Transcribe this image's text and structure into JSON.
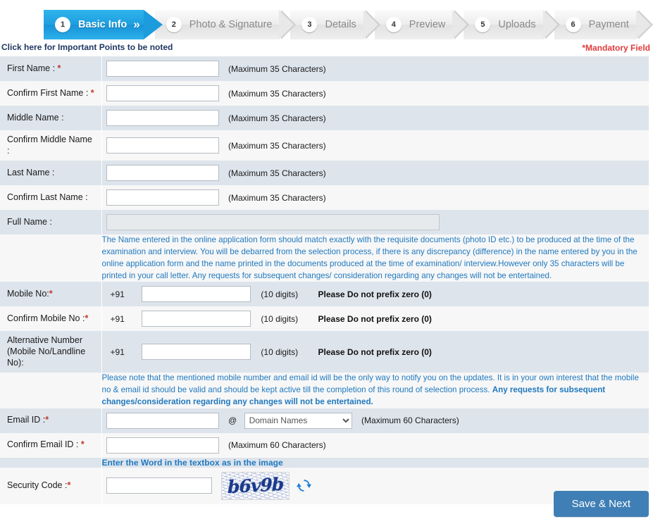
{
  "wizard": {
    "steps": [
      {
        "num": "1",
        "label": "Basic Info",
        "active": true
      },
      {
        "num": "2",
        "label": "Photo & Signature",
        "active": false
      },
      {
        "num": "3",
        "label": "Details",
        "active": false
      },
      {
        "num": "4",
        "label": "Preview",
        "active": false
      },
      {
        "num": "5",
        "label": "Uploads",
        "active": false
      },
      {
        "num": "6",
        "label": "Payment",
        "active": false
      }
    ],
    "chevron_glyph": "»"
  },
  "subheader": {
    "important_link": "Click here for Important Points to be noted",
    "mandatory_note": "*Mandatory Field"
  },
  "form": {
    "labels": {
      "first_name": "First Name : ",
      "confirm_first_name": "Confirm First Name : ",
      "middle_name": "Middle Name :",
      "confirm_middle_name": "Confirm Middle Name :",
      "last_name": "Last Name :",
      "confirm_last_name": "Confirm Last Name :",
      "full_name": "Full Name :",
      "mobile_no": "Mobile No:",
      "confirm_mobile_no": "Confirm Mobile No :",
      "alternative_number_line1": "Alternative Number",
      "alternative_number_line2": "(Mobile No/Landline No):",
      "email_id": "Email ID :",
      "confirm_email_id": "Confirm Email ID : ",
      "security_code": "Security Code :"
    },
    "required_marker": "*",
    "hints": {
      "max35": "(Maximum 35 Characters)",
      "max60": "(Maximum 60 Characters)",
      "ten_digits": "(10 digits)",
      "no_prefix_zero": "Please Do not prefix zero (0)"
    },
    "values": {
      "first_name": "",
      "confirm_first_name": "",
      "middle_name": "",
      "confirm_middle_name": "",
      "last_name": "",
      "confirm_last_name": "",
      "full_name": "",
      "mobile_no": "",
      "confirm_mobile_no": "",
      "alternative_number": "",
      "email_id": "",
      "confirm_email_id": "",
      "security_code": ""
    },
    "country_prefix": "+91",
    "at_symbol": "@",
    "domain_select": {
      "selected": "Domain Names",
      "options": [
        "Domain Names"
      ]
    },
    "name_note": "The Name entered in the online application form should match exactly with the requisite documents (photo ID etc.) to be produced at the time of the examination and interview. You will be debarred from the selection process, if there is any discrepancy (difference) in the name entered by you in the online application form and the name printed in the documents produced at the time of examination/ interview.However only 35 characters will be printed in your call letter. Any requests for subsequent changes/ consideration regarding any changes will not be entertained.",
    "contact_note_normal": "Please note that the mentioned mobile number and email id will be the only way to notify you on the updates. It is in your own interest that the mobile no & email id should be valid and should be kept active till the completion of this round of selection process. ",
    "contact_note_bold": "Any requests for subsequent changes/consideration regarding any changes will not be entertained.",
    "captcha_instruction": "Enter the Word in the textbox as in the image",
    "captcha_text": "b6v9b"
  },
  "footer": {
    "save_next_label": "Save & Next"
  },
  "colors": {
    "active_step": "#1e9fe0",
    "row_odd": "#dde4ec",
    "row_even": "#f7f7f7",
    "note_text": "#2079bf",
    "required": "#c0392b",
    "mandatory": "#e23b3b",
    "save_button": "#3f7fb5",
    "important_link": "#1f3864"
  }
}
